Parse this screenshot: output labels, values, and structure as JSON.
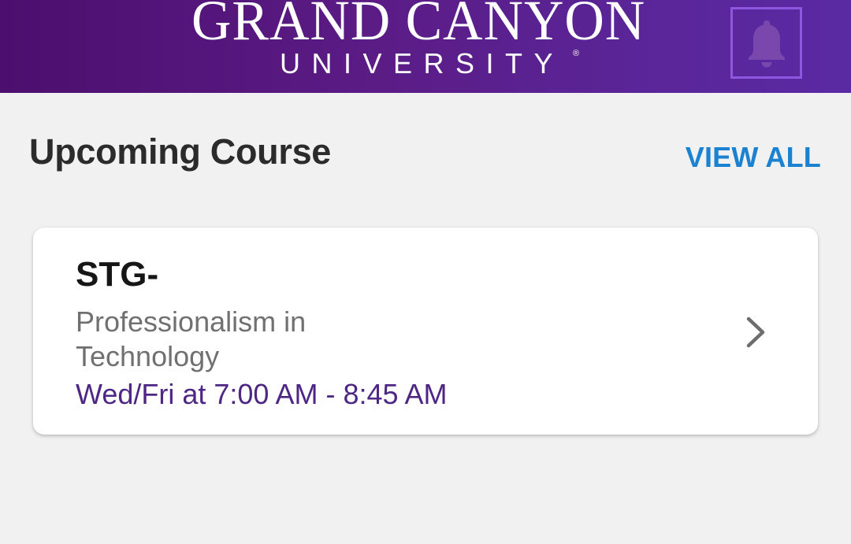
{
  "header": {
    "logo_main": "GRAND CANYON",
    "logo_sub": "UNIVERSITY",
    "logo_reg": "®",
    "notification_icon": "bell-icon",
    "brand_color": "#531482"
  },
  "upcoming": {
    "title": "Upcoming Course",
    "view_all_label": "VIEW ALL",
    "link_color": "#1a82d1"
  },
  "course": {
    "code": "STG-",
    "name": "Professionalism in Technology",
    "schedule": "Wed/Fri at 7:00 AM - 8:45 AM",
    "schedule_color": "#4e2683",
    "chevron_icon": "chevron-right-icon"
  }
}
